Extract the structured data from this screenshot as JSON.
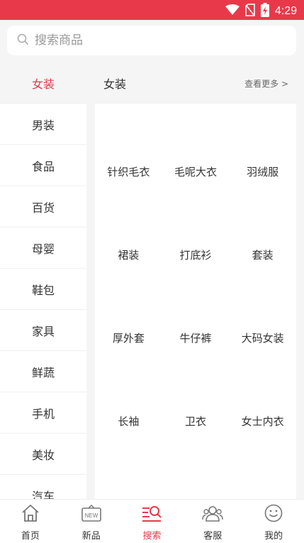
{
  "status": {
    "time": "4:29"
  },
  "search": {
    "placeholder": "搜索商品"
  },
  "sidebar": {
    "items": [
      {
        "label": "女装",
        "active": true
      },
      {
        "label": "男装"
      },
      {
        "label": "食品"
      },
      {
        "label": "百货"
      },
      {
        "label": "母婴"
      },
      {
        "label": "鞋包"
      },
      {
        "label": "家具"
      },
      {
        "label": "鲜蔬"
      },
      {
        "label": "手机"
      },
      {
        "label": "美妆"
      },
      {
        "label": "汽车"
      }
    ]
  },
  "content": {
    "title": "女装",
    "more": "查看更多 >",
    "subcategories": [
      "针织毛衣",
      "毛呢大衣",
      "羽绒服",
      "裙装",
      "打底衫",
      "套装",
      "厚外套",
      "牛仔裤",
      "大码女装",
      "长袖",
      "卫衣",
      "女士内衣"
    ]
  },
  "nav": {
    "items": [
      {
        "label": "首页",
        "icon": "home-icon"
      },
      {
        "label": "新品",
        "icon": "new-icon",
        "badge": "NEW"
      },
      {
        "label": "搜索",
        "icon": "search-icon",
        "active": true
      },
      {
        "label": "客服",
        "icon": "service-icon"
      },
      {
        "label": "我的",
        "icon": "smile-icon"
      }
    ]
  },
  "colors": {
    "accent": "#e8394b",
    "background": "#f5f5f5"
  }
}
